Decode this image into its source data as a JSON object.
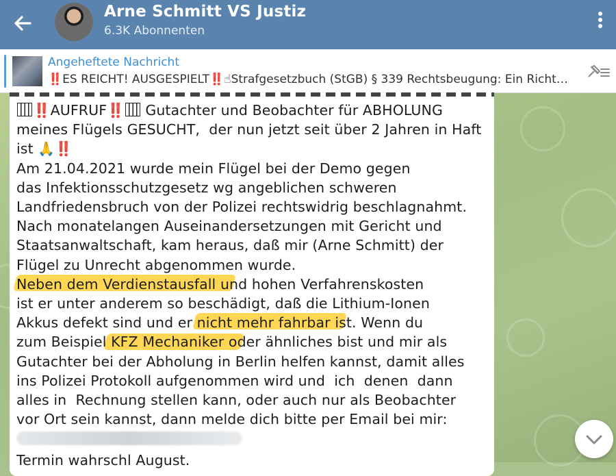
{
  "header": {
    "title": "Arne Schmitt VS Justiz",
    "subscribers": "6.3K Abonnenten",
    "back_icon": "arrow-left-icon",
    "menu_icon": "more-vert-icon"
  },
  "pinned": {
    "title": "Angeheftete Nachricht",
    "excl1": "‼️",
    "text_a": "ES REICHT! AUSGESPIELT",
    "excl2": "‼️",
    "emoji": "☝",
    "text_b": "Strafgesetzbuch (StGB) § 339 Rechtsbeugung: Ein Richter,..."
  },
  "message": {
    "l1_a": "AUFRUF",
    "l1_ex1": "‼️",
    "l1_ex2": "‼️",
    "l1_b": " Gutachter und Beobachter für ABHOLUNG",
    "l2": "meines Flügels GESUCHT,  der nun jetzt seit über 2 Jahren in Haft",
    "l3_a": "ist ",
    "l3_pray": "🙏",
    "l3_ex": "‼️",
    "l4": "Am 21.04.2021 wurde mein Flügel bei der Demo gegen",
    "l5": "das Infektionsschutzgesetz wg angeblichen schweren",
    "l6": "Landfriedensbruch von der Polizei rechtswidrig beschlagnahmt.",
    "l7": "Nach monatelangen Auseinandersetzungen mit Gericht und",
    "l8": "Staatsanwaltschaft, kam heraus, daß mir (Arne Schmitt) der",
    "l9": "Flügel zu Unrecht abgenommen wurde.",
    "l10": "Neben dem Verdienstausfall und hohen Verfahrenskosten",
    "l11": "ist er unter anderem so beschädigt, daß die Lithium-Ionen",
    "l12": "Akkus defekt sind und er nicht mehr fahrbar ist. Wenn du",
    "l13": "zum Beispiel KFZ Mechaniker oder ähnliches bist und mir als",
    "l14": "Gutachter bei der Abholung in Berlin helfen kannst, damit alles",
    "l15": "ins Polizei Protokoll aufgenommen wird und  ich  denen  dann",
    "l16": "alles in  Rechnung stellen kann, oder auch nur als Beobachter",
    "l17": "vor Ort sein kannst, dann melde dich bitte per Email bei mir:",
    "l19": "Termin wahrschl August."
  },
  "colors": {
    "header_bg": "#5a84ad",
    "link_blue": "#3f8fd1",
    "highlight": "#ffc814",
    "red_emoji": "#e8141c"
  },
  "scroll_icon": "chevron-down-icon"
}
